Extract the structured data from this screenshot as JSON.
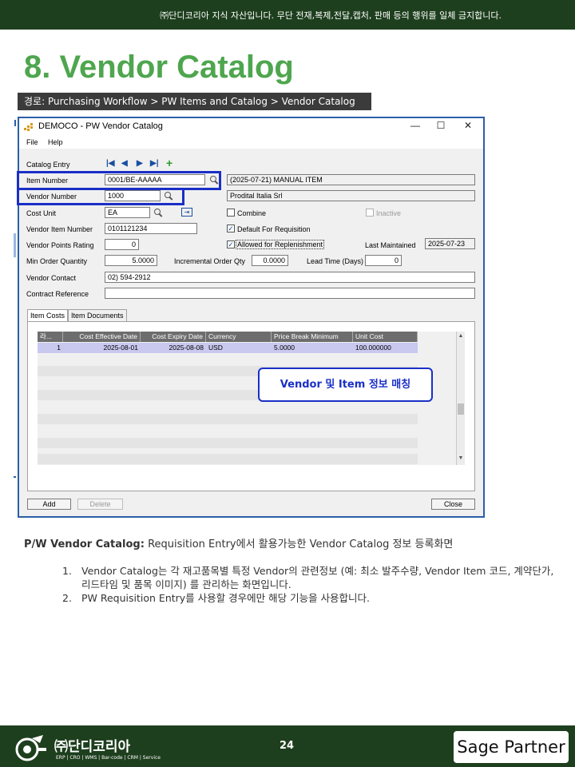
{
  "top_banner": "㈜단디코리아 지식 자산입니다. 무단 전재,복제,전달,캡처, 판매 등의 행위를 일체 금지합니다.",
  "slide_title": "8. Vendor Catalog",
  "breadcrumb": "경로: Purchasing Workflow > PW Items and Catalog > Vendor Catalog",
  "window": {
    "title": "DEMOCO - PW Vendor Catalog",
    "controls": {
      "minimize": "—",
      "maximize": "☐",
      "close": "✕"
    },
    "menu": [
      "File",
      "Help"
    ],
    "catalog_entry_label": "Catalog Entry",
    "nav_icons": [
      "first-icon",
      "prev-icon",
      "next-icon",
      "last-icon",
      "add-icon"
    ],
    "nav_glyphs": [
      "|◀",
      "◀",
      "▶",
      "▶|",
      "+"
    ],
    "fields": {
      "item_number": {
        "label": "Item Number",
        "value": "0001/BE-AAAAA",
        "desc": "(2025-07-21) MANUAL ITEM"
      },
      "vendor_number": {
        "label": "Vendor Number",
        "value": "1000",
        "desc": "Prodital Italia Srl"
      },
      "cost_unit": {
        "label": "Cost Unit",
        "value": "EA"
      },
      "vendor_item_number": {
        "label": "Vendor Item Number",
        "value": "0101121234"
      },
      "vendor_points_rating": {
        "label": "Vendor Points Rating",
        "value": "0"
      },
      "min_order_qty": {
        "label": "Min Order Quantity",
        "value": "5.0000"
      },
      "incremental_order_qty": {
        "label": "Incremental Order Qty",
        "value": "0.0000"
      },
      "lead_time": {
        "label": "Lead Time (Days)",
        "value": "0"
      },
      "vendor_contact": {
        "label": "Vendor Contact",
        "value": "02) 594-2912"
      },
      "contract_reference": {
        "label": "Contract Reference",
        "value": ""
      },
      "last_maintained": {
        "label": "Last Maintained",
        "value": "2025-07-23"
      }
    },
    "checkboxes": {
      "combine": {
        "label": "Combine",
        "checked": false
      },
      "inactive": {
        "label": "Inactive",
        "checked": false
      },
      "default_for_requisition": {
        "label": "Default For Requisition",
        "checked": true
      },
      "allowed_for_replenishment": {
        "label": "Allowed for Replenishment",
        "checked": true
      }
    },
    "check_mark": "✓",
    "tabs": [
      "Item Costs",
      "Item Documents"
    ],
    "grid": {
      "columns": [
        "라...",
        "Cost Effective Date",
        "Cost Expiry Date",
        "Currency",
        "Price Break Minimum",
        "Unit Cost"
      ],
      "rows": [
        [
          "1",
          "2025-08-01",
          "2025-08-08",
          "USD",
          "5.0000",
          "100.000000"
        ]
      ]
    },
    "scroll_up": "▲",
    "scroll_down": "▼",
    "callout": "Vendor 및 Item 정보 매칭",
    "buttons": {
      "add": "Add",
      "delete": "Delete",
      "close": "Close"
    }
  },
  "description": {
    "heading": "P/W Vendor Catalog:",
    "text": " Requisition Entry에서 활용가능한 Vendor Catalog 정보 등록화면",
    "items": [
      {
        "num": "1.",
        "text": "Vendor Catalog는 각 재고품목별 특정 Vendor의 관련정보 (예: 최소 발주수량, Vendor Item 코드, 계약단가, 리드타임 및 품목 이미지) 를 관리하는 화면입니다."
      },
      {
        "num": "2.",
        "text": "PW Requisition Entry를 사용할 경우에만 해당 기능을 사용합니다."
      }
    ]
  },
  "footer": {
    "brand": "㈜단디코리아",
    "tagline": "ERP | CRO | WMS | Bar-code | CRM | Service",
    "page_number": "24",
    "partner": "Sage Partner"
  },
  "colors": {
    "dark_green": "#1e3f1e",
    "title_green": "#4ea64e",
    "highlight_blue": "#1a2fc6",
    "row_select": "#c9c8ef"
  }
}
